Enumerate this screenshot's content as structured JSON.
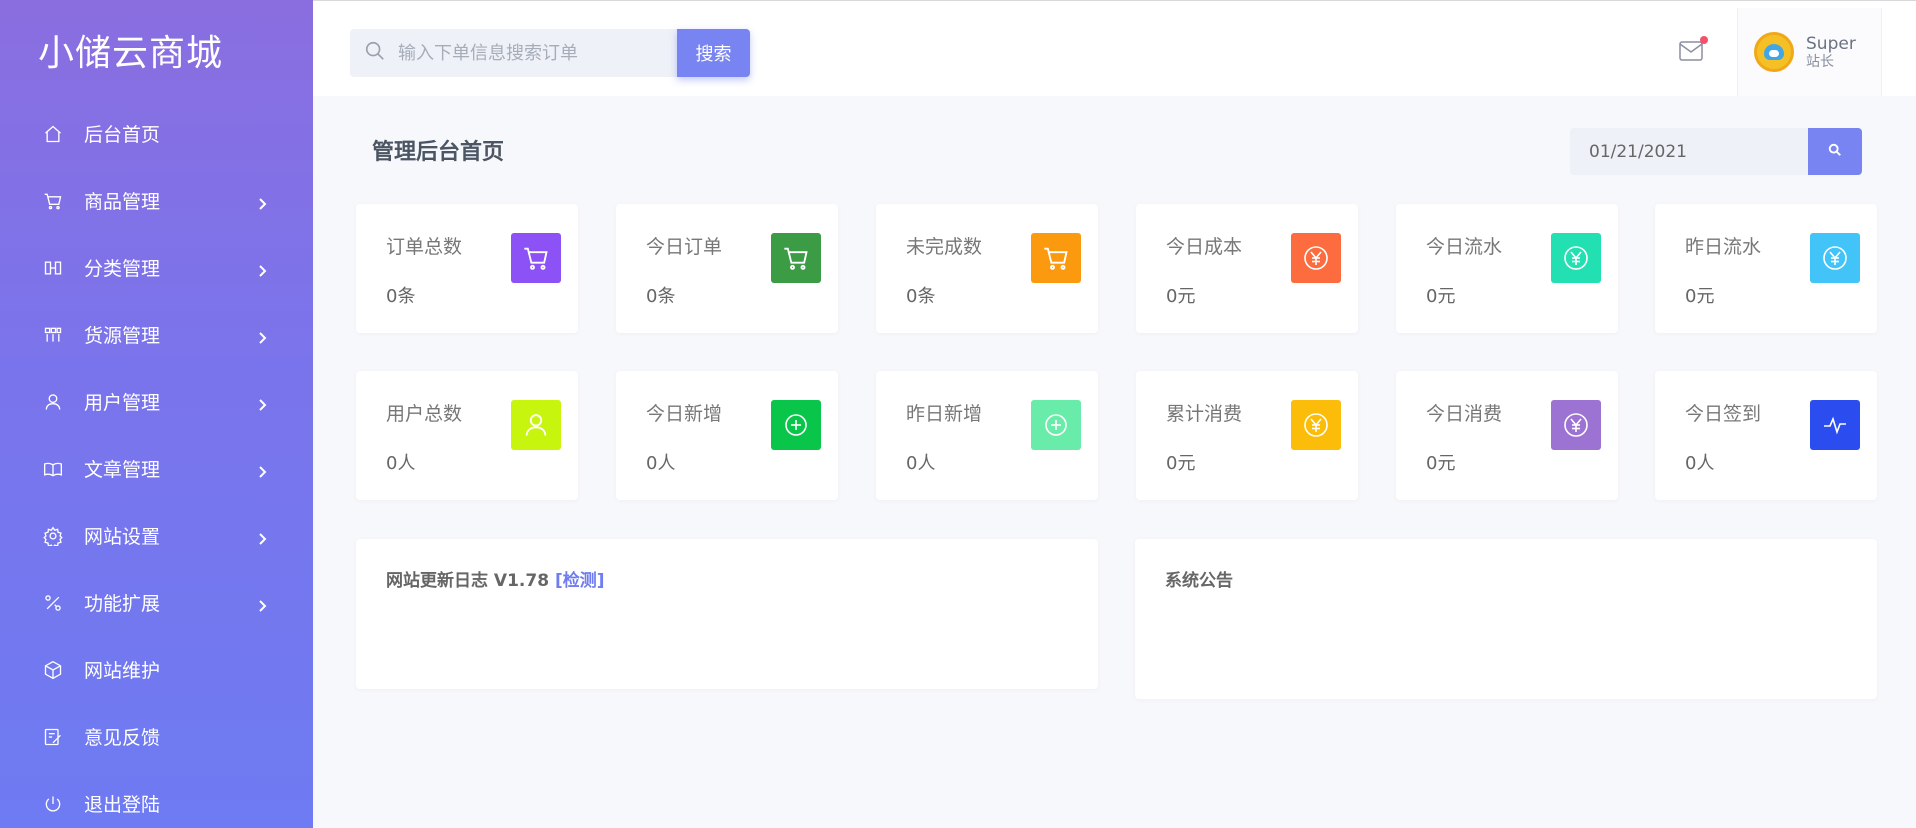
{
  "brand": "小储云商城",
  "sidebar": {
    "items": [
      {
        "label": "后台首页",
        "icon": "home-icon",
        "chevron": false
      },
      {
        "label": "商品管理",
        "icon": "cart-icon",
        "chevron": true
      },
      {
        "label": "分类管理",
        "icon": "columns-icon",
        "chevron": true
      },
      {
        "label": "货源管理",
        "icon": "grid-icon",
        "chevron": true
      },
      {
        "label": "用户管理",
        "icon": "user-icon",
        "chevron": true
      },
      {
        "label": "文章管理",
        "icon": "book-icon",
        "chevron": true
      },
      {
        "label": "网站设置",
        "icon": "gear-icon",
        "chevron": true
      },
      {
        "label": "功能扩展",
        "icon": "tools-icon",
        "chevron": true
      },
      {
        "label": "网站维护",
        "icon": "cube-icon",
        "chevron": false
      },
      {
        "label": "意见反馈",
        "icon": "feedback-icon",
        "chevron": false
      },
      {
        "label": "退出登陆",
        "icon": "power-icon",
        "chevron": false
      }
    ]
  },
  "header": {
    "search_placeholder": "输入下单信息搜索订单",
    "search_button": "搜索",
    "user_name": "Super",
    "user_role": "站长"
  },
  "main": {
    "title": "管理后台首页",
    "date": "01/21/2021",
    "stats": [
      {
        "label": "订单总数",
        "value": "0条",
        "color": "#8c52f6",
        "icon": "cart-icon"
      },
      {
        "label": "今日订单",
        "value": "0条",
        "color": "#3c9b45",
        "icon": "cart-icon"
      },
      {
        "label": "未完成数",
        "value": "0条",
        "color": "#fb9a0f",
        "icon": "cart-icon"
      },
      {
        "label": "今日成本",
        "value": "0元",
        "color": "#fc6c3e",
        "icon": "yen-icon"
      },
      {
        "label": "今日流水",
        "value": "0元",
        "color": "#22e0b2",
        "icon": "yen-icon"
      },
      {
        "label": "昨日流水",
        "value": "0元",
        "color": "#42c4f9",
        "icon": "yen-icon"
      },
      {
        "label": "用户总数",
        "value": "0人",
        "color": "#c8f50e",
        "icon": "user-icon"
      },
      {
        "label": "今日新增",
        "value": "0人",
        "color": "#09c54a",
        "icon": "plus-circle-icon"
      },
      {
        "label": "昨日新增",
        "value": "0人",
        "color": "#69ecaa",
        "icon": "plus-circle-icon"
      },
      {
        "label": "累计消费",
        "value": "0元",
        "color": "#fcbd0a",
        "icon": "yen-icon"
      },
      {
        "label": "今日消费",
        "value": "0元",
        "color": "#9c72d2",
        "icon": "yen-icon"
      },
      {
        "label": "今日签到",
        "value": "0人",
        "color": "#2b4cef",
        "icon": "pulse-icon"
      }
    ],
    "update_log": {
      "title": "网站更新日志 V1.78",
      "link": "[检测]"
    },
    "announcement": {
      "title": "系统公告"
    }
  }
}
